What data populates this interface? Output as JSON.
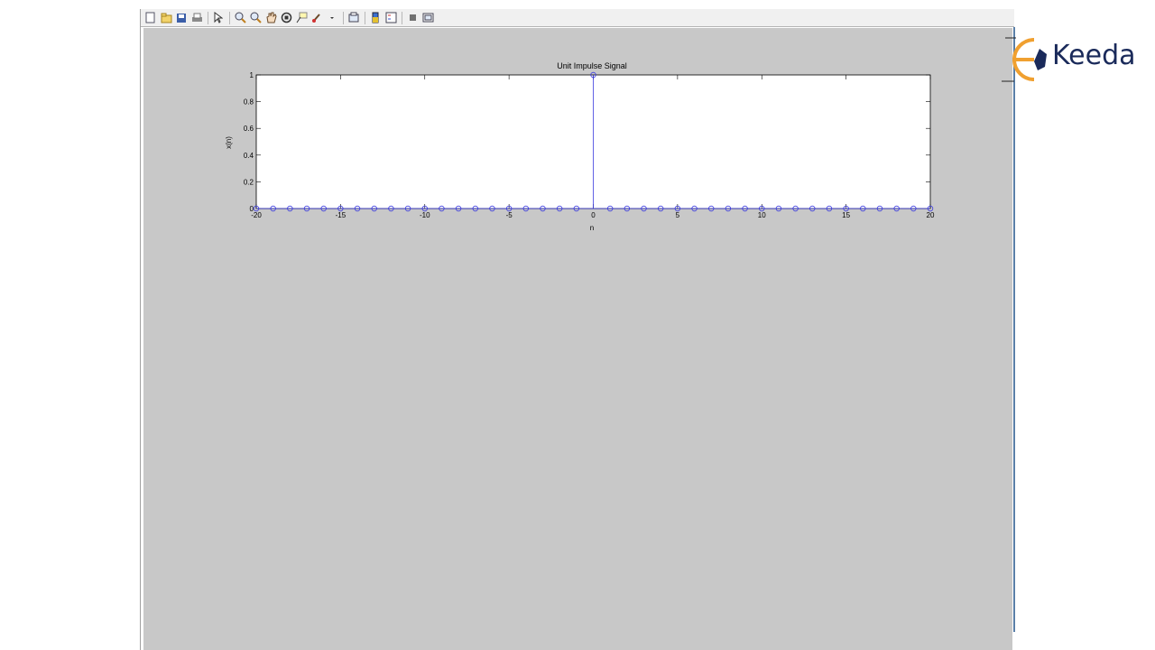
{
  "toolbar": {
    "icons": [
      "new-figure-icon",
      "open-file-icon",
      "save-icon",
      "print-icon",
      "edit-plot-icon",
      "zoom-in-icon",
      "zoom-out-icon",
      "pan-icon",
      "rotate-3d-icon",
      "data-cursor-icon",
      "brush-icon",
      "link-plot-icon",
      "insert-colorbar-icon",
      "insert-legend-icon",
      "hide-plot-tools-icon",
      "show-plot-tools-icon"
    ]
  },
  "colors": {
    "canvas": "#c8c8c8",
    "axes_bg": "#ffffff",
    "stem": "#3a3adf",
    "accent_logo": "#f0a030",
    "logo_text": "#1a2a5a"
  },
  "chart_data": {
    "type": "scatter",
    "style": "stem",
    "title": "Unit Impulse Signal",
    "xlabel": "n",
    "ylabel": "x(n)",
    "xlim": [
      -20,
      20
    ],
    "ylim": [
      0,
      1
    ],
    "xticks": [
      -20,
      -15,
      -10,
      -5,
      0,
      5,
      10,
      15,
      20
    ],
    "xtick_labels": [
      "-20",
      "-15",
      "-10",
      "-5",
      "0",
      "5",
      "10",
      "15",
      "20"
    ],
    "yticks": [
      0,
      0.2,
      0.4,
      0.6,
      0.8,
      1
    ],
    "ytick_labels": [
      "0",
      "0.2",
      "0.4",
      "0.6",
      "0.8",
      "1"
    ],
    "x": [
      -20,
      -19,
      -18,
      -17,
      -16,
      -15,
      -14,
      -13,
      -12,
      -11,
      -10,
      -9,
      -8,
      -7,
      -6,
      -5,
      -4,
      -3,
      -2,
      -1,
      0,
      1,
      2,
      3,
      4,
      5,
      6,
      7,
      8,
      9,
      10,
      11,
      12,
      13,
      14,
      15,
      16,
      17,
      18,
      19,
      20
    ],
    "y": [
      0,
      0,
      0,
      0,
      0,
      0,
      0,
      0,
      0,
      0,
      0,
      0,
      0,
      0,
      0,
      0,
      0,
      0,
      0,
      0,
      1,
      0,
      0,
      0,
      0,
      0,
      0,
      0,
      0,
      0,
      0,
      0,
      0,
      0,
      0,
      0,
      0,
      0,
      0,
      0,
      0
    ],
    "grid": false
  },
  "logo": {
    "text": "Keeda"
  }
}
